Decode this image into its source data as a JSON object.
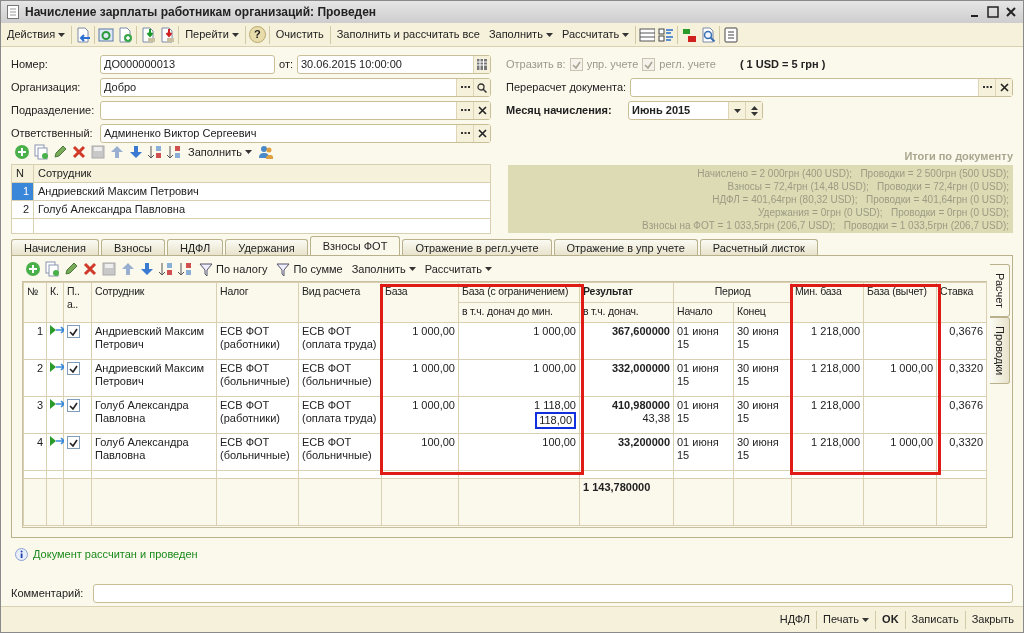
{
  "window": {
    "title": "Начисление зарплаты работникам организаций: Проведен"
  },
  "toolbar": {
    "actions": "Действия",
    "goto": "Перейти",
    "help": "?",
    "clear": "Очистить",
    "fill_all": "Заполнить и рассчитать все",
    "fill": "Заполнить",
    "calculate": "Рассчитать"
  },
  "header": {
    "number": {
      "label": "Номер:",
      "value": "ДО000000013"
    },
    "date": {
      "label": "от:",
      "value": "30.06.2015 10:00:00"
    },
    "organization": {
      "label": "Организация:",
      "value": "Добро"
    },
    "subdivision": {
      "label": "Подразделение:"
    },
    "responsible": {
      "label": "Ответственный:",
      "value": "Админенко Виктор Сергеевич"
    },
    "reflect": {
      "label": "Отразить в:",
      "disabled": true,
      "options": [
        {
          "label": "упр. учете",
          "checked": true
        },
        {
          "label": "регл. учете",
          "checked": true
        }
      ]
    },
    "rate_note": "( 1 USD = 5 грн )",
    "recalc": {
      "label": "Перерасчет документа:"
    },
    "month": {
      "label": "Месяц начисления:",
      "value": "Июнь 2015"
    }
  },
  "employees": {
    "fill": "Заполнить",
    "columns": [
      "N",
      "Сотрудник"
    ],
    "rows": [
      {
        "n": "1",
        "name": "Андриевский Максим Петрович",
        "selected": true
      },
      {
        "n": "2",
        "name": "Голуб Александра Павловна",
        "selected": false
      }
    ]
  },
  "totals": {
    "title": "Итоги по документу",
    "lines": [
      "Начислено = 2 000грн (400 USD);   Проводки = 2 500грн (500 USD);",
      "Взносы = 72,4грн (14,48 USD);   Проводки = 72,4грн (0 USD);",
      "НДФЛ = 401,64грн (80,32 USD);   Проводки = 401,64грн (0 USD);",
      "Удержания = 0грн (0 USD);   Проводки = 0грн (0 USD);",
      "Взносы на ФОТ = 1 033,5грн (206,7 USD);   Проводки = 1 033,5грн (206,7 USD);"
    ]
  },
  "tabs": [
    {
      "label": "Начисления",
      "selected": false
    },
    {
      "label": "Взносы",
      "selected": false
    },
    {
      "label": "НДФЛ",
      "selected": false
    },
    {
      "label": "Удержания",
      "selected": false
    },
    {
      "label": "Взносы ФОТ",
      "selected": true
    },
    {
      "label": "Отражение в регл.учете",
      "selected": false
    },
    {
      "label": "Отражение в упр учете",
      "selected": false
    },
    {
      "label": "Расчетный листок",
      "selected": false
    }
  ],
  "side_tabs": [
    {
      "label": "Расчет",
      "selected": true
    },
    {
      "label": "Проводки",
      "selected": false
    }
  ],
  "grid": {
    "toolbar": {
      "by_tax": "По налогу",
      "by_sum": "По сумме",
      "fill": "Заполнить",
      "calculate": "Рассчитать"
    },
    "columns": [
      {
        "label": "№",
        "framed": false,
        "bold": false
      },
      {
        "label": "К.",
        "framed": false,
        "bold": false
      },
      {
        "label": "П.. а..",
        "framed": false,
        "bold": false
      },
      {
        "label": "Сотрудник",
        "framed": false,
        "bold": false
      },
      {
        "label": "Налог",
        "framed": false,
        "bold": false
      },
      {
        "label": "Вид расчета",
        "framed": false,
        "bold": false
      },
      {
        "label": "База",
        "framed": true,
        "bold": false
      },
      {
        "label": "База (с ограничением)",
        "sublabel": "в т.ч. донач до мин.",
        "framed": true,
        "bold": false
      },
      {
        "label": "Результат",
        "sublabel": "в т.ч. донач.",
        "framed": false,
        "bold": true
      },
      {
        "label": "Период",
        "framed": false,
        "bold": false,
        "children": [
          {
            "label": "Начало"
          },
          {
            "label": "Конец"
          }
        ]
      },
      {
        "label": "Мин. база",
        "framed": true,
        "bold": false
      },
      {
        "label": "База (вычет)",
        "framed": true,
        "bold": false
      },
      {
        "label": "Ставка",
        "framed": false,
        "bold": false
      }
    ],
    "rows": [
      {
        "number": "1",
        "checked": true,
        "employee": "Андриевский Максим Петрович",
        "tax": "ЕСВ ФОТ (работники)",
        "calc_type": "ЕСВ ФОТ (оплата труда)",
        "base": "1 000,00",
        "base_limited": "1 000,00",
        "result": "367,600000",
        "start": "01 июня 15",
        "end": "30 июня 15",
        "min_base": "1 218,000",
        "rate": "0,3676"
      },
      {
        "number": "2",
        "checked": true,
        "employee": "Андриевский Максим Петрович",
        "tax": "ЕСВ ФОТ (больничные)",
        "calc_type": "ЕСВ ФОТ (больничные)",
        "base": "1 000,00",
        "base_limited": "1 000,00",
        "result": "332,000000",
        "start": "01 июня 15",
        "end": "30 июня 15",
        "min_base": "1 218,000",
        "base_deduction": "1 000,00",
        "rate": "0,3320"
      },
      {
        "number": "3",
        "checked": true,
        "employee": "Голуб Александра Павловна",
        "tax": "ЕСВ ФОТ (работники)",
        "calc_type": "ЕСВ ФОТ (оплата труда)",
        "base": "1 000,00",
        "base_limited": "1 118,00",
        "base_limited_extra": {
          "value": "118,00",
          "selected": true
        },
        "result": "410,980000",
        "result_extra": "43,38",
        "start": "01 июня 15",
        "end": "30 июня 15",
        "min_base": "1 218,000",
        "rate": "0,3676"
      },
      {
        "number": "4",
        "checked": true,
        "employee": "Голуб Александра Павловна",
        "tax": "ЕСВ ФОТ (больничные)",
        "calc_type": "ЕСВ ФОТ (больничные)",
        "base": "100,00",
        "base_limited": "100,00",
        "result": "33,200000",
        "start": "01 июня 15",
        "end": "30 июня 15",
        "min_base": "1 218,000",
        "base_deduction": "1 000,00",
        "rate": "0,3320"
      }
    ],
    "total_result": "1 143,780000"
  },
  "status": "Документ рассчитан и проведен",
  "comment": {
    "label": "Комментарий:"
  },
  "buttons": [
    {
      "label": "НДФЛ",
      "kind": "plain"
    },
    {
      "label": "Печать",
      "kind": "menu"
    },
    {
      "label": "OK",
      "kind": "default"
    },
    {
      "label": "Записать",
      "kind": "plain"
    },
    {
      "label": "Закрыть",
      "kind": "plain"
    }
  ]
}
